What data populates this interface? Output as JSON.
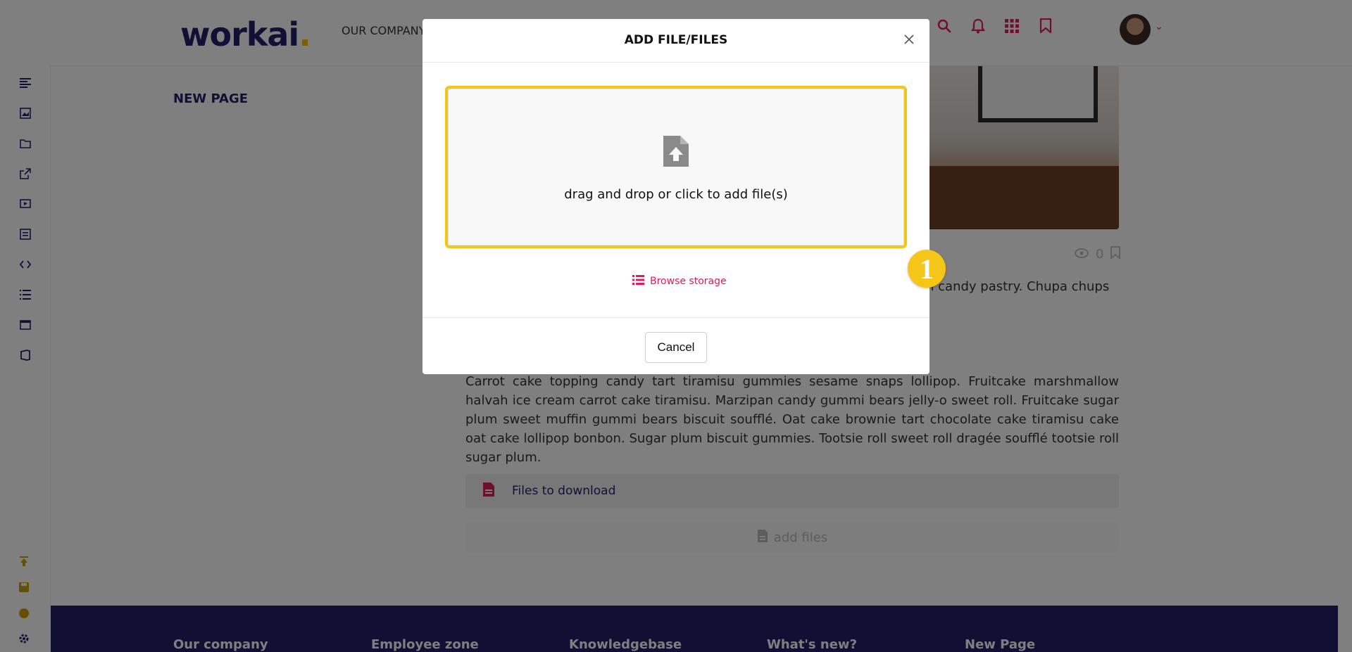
{
  "app": {
    "logo_text": "workai",
    "logo_dot": ".",
    "top_nav_label": "OUR COMPANY",
    "colors": {
      "brand": "#232069",
      "accent": "#e21a5a",
      "highlight": "#f5c518"
    }
  },
  "header_icons": [
    "search-icon",
    "bell-icon",
    "apps-grid-icon",
    "bookmark-icon"
  ],
  "page": {
    "title": "NEW PAGE",
    "views_count": "0",
    "para1": "…oll jelly oat cake. Pastry dessert …ufflé candy croissant candy. Car- …on candy pastry. Chupa chups",
    "para2": "Carrot cake topping candy tart tiramisu gummies sesame snaps lollipop. Fruitcake marshmallow halvah ice cream carrot cake tiramisu. Marzipan candy gummi bears jelly-o sweet roll. Fruitcake sugar plum sweet muffin gummi bears biscuit soufflé. Oat cake brownie tart chocolate cake tiramisu cake oat cake lollipop bonbon. Sugar plum biscuit gummies. Tootsie roll sweet roll dragée soufflé tootsie roll sugar plum.",
    "files_section_label": "Files to download",
    "add_files_label": "add files"
  },
  "footer": {
    "columns": [
      "Our company",
      "Employee zone",
      "Knowledgebase",
      "What's new?",
      "New Page"
    ]
  },
  "modal": {
    "title": "ADD FILE/FILES",
    "dropzone_text": "drag and drop or click to add file(s)",
    "browse_label": "Browse storage",
    "cancel_label": "Cancel"
  },
  "step_badge": "1"
}
